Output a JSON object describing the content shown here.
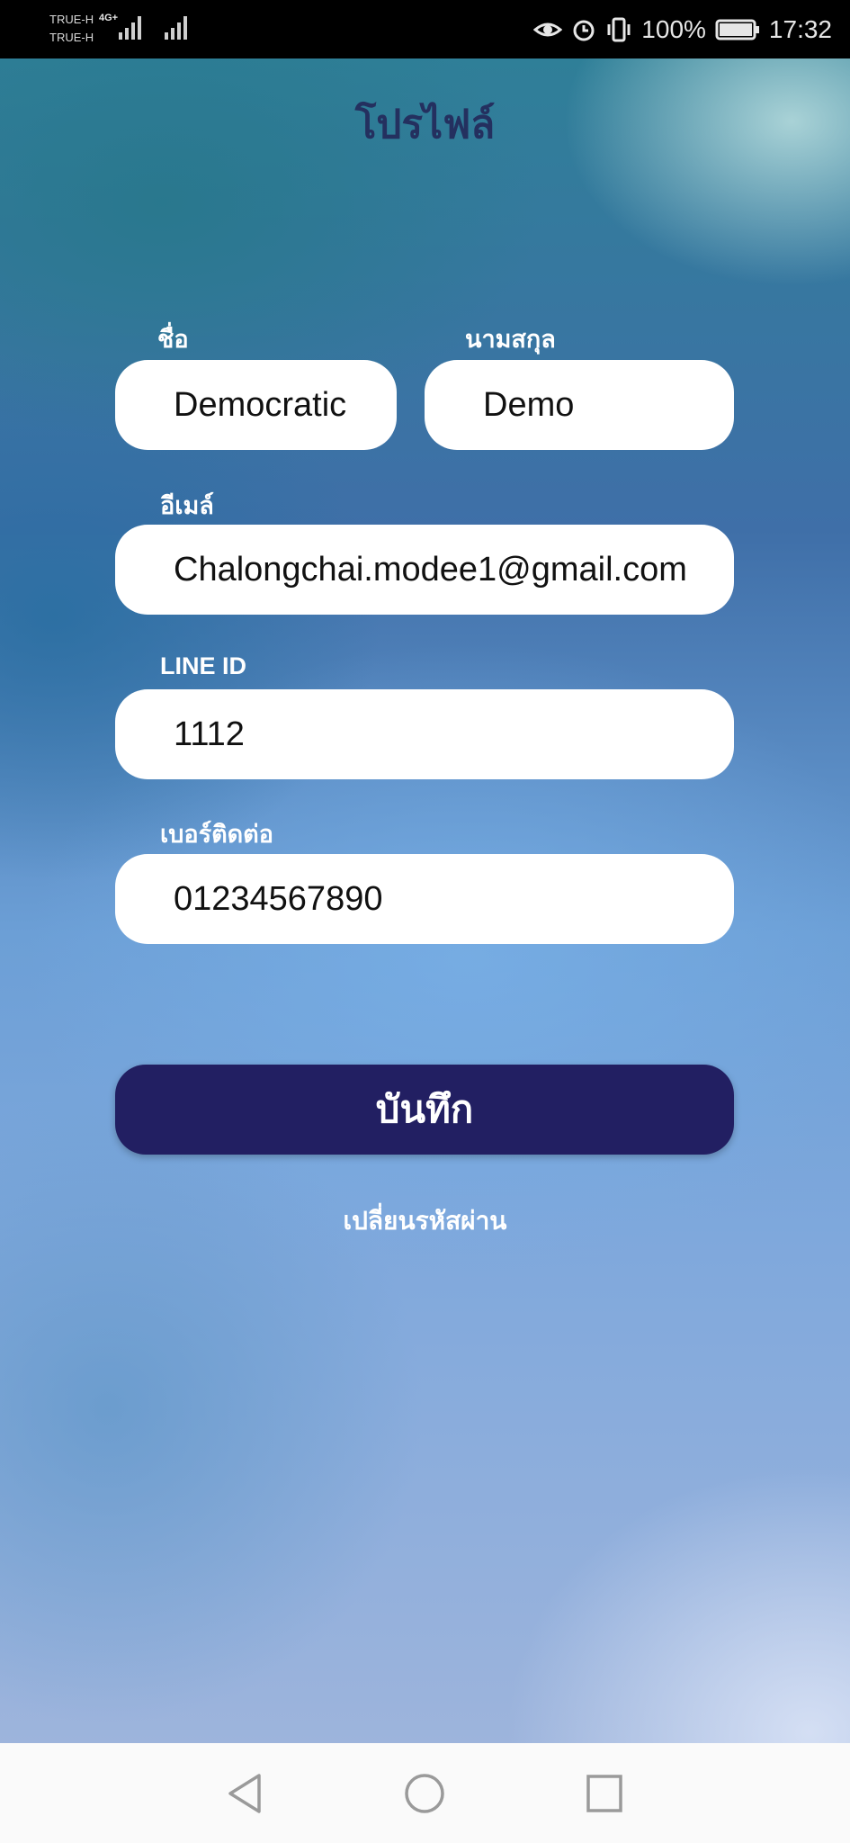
{
  "status_bar": {
    "carrier_1": "TRUE-H",
    "carrier_2": "TRUE-H",
    "network_type": "4G+",
    "battery": "100%",
    "time": "17:32"
  },
  "header": {
    "title": "โปรไฟล์"
  },
  "form": {
    "first_name": {
      "label": "ชื่อ",
      "value": "Democratic"
    },
    "last_name": {
      "label": "นามสกุล",
      "value": "Demo"
    },
    "email": {
      "label": "อีเมล์",
      "value": "Chalongchai.modee1@gmail.com"
    },
    "line_id": {
      "label": "LINE ID",
      "value": "1112"
    },
    "phone": {
      "label": "เบอร์ติดต่อ",
      "value": "01234567890"
    }
  },
  "actions": {
    "save_label": "บันทึก",
    "change_password_label": "เปลี่ยนรหัสผ่าน"
  },
  "nav_bar": {
    "icons": [
      "back-icon",
      "home-icon",
      "recents-icon"
    ]
  }
}
